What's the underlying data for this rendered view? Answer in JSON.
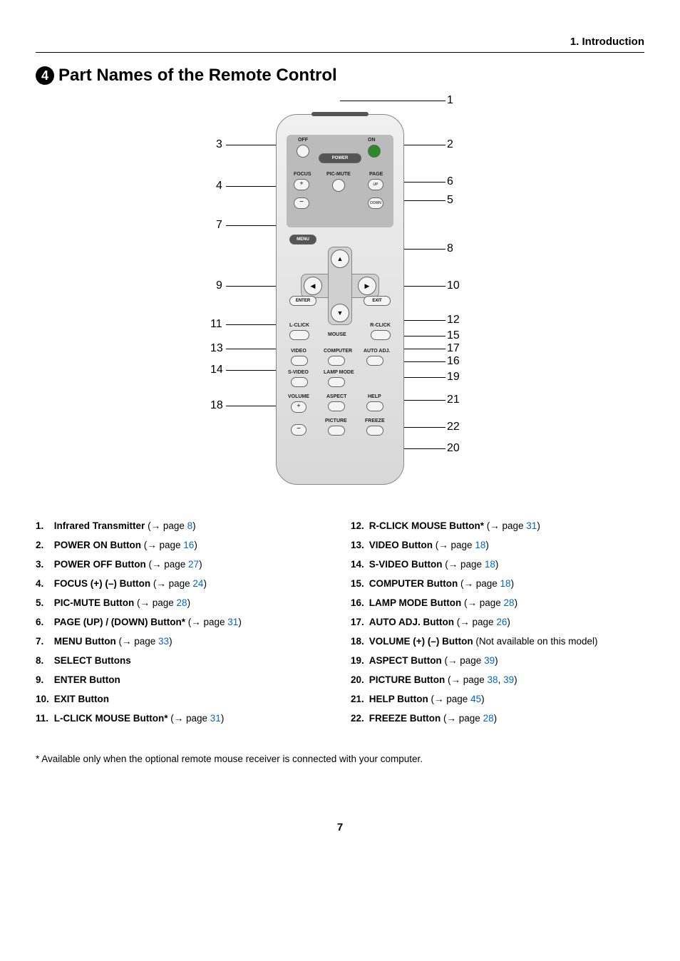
{
  "header": {
    "section": "1. Introduction"
  },
  "title": {
    "num": "4",
    "text": "Part Names of the Remote Control"
  },
  "remote_labels": {
    "off": "OFF",
    "on": "ON",
    "power": "POWER",
    "focus": "FOCUS",
    "picmute": "PIC-MUTE",
    "page": "PAGE",
    "up": "UP",
    "down": "DOWN",
    "menu": "MENU",
    "enter": "ENTER",
    "exit": "EXIT",
    "lclick": "L-CLICK",
    "rclick": "R-CLICK",
    "mouse": "MOUSE",
    "video": "VIDEO",
    "computer": "COMPUTER",
    "autoadj": "AUTO ADJ.",
    "svideo": "S-VIDEO",
    "lampmode": "LAMP MODE",
    "volume": "VOLUME",
    "aspect": "ASPECT",
    "help": "HELP",
    "picture": "PICTURE",
    "freeze": "FREEZE"
  },
  "callouts": {
    "1": "1",
    "2": "2",
    "3": "3",
    "4": "4",
    "5": "5",
    "6": "6",
    "7": "7",
    "8": "8",
    "9": "9",
    "10": "10",
    "11": "11",
    "12": "12",
    "13": "13",
    "14": "14",
    "15": "15",
    "16": "16",
    "17": "17",
    "18": "18",
    "19": "19",
    "20": "20",
    "21": "21",
    "22": "22"
  },
  "list_left": [
    {
      "n": "1.",
      "name": "Infrared Transmitter",
      "arrow": "→ page ",
      "page": "8",
      "close": ")"
    },
    {
      "n": "2.",
      "name": "POWER ON Button",
      "arrow": "→ page ",
      "page": "16",
      "close": ")"
    },
    {
      "n": "3.",
      "name": "POWER OFF Button",
      "arrow": "→ page ",
      "page": "27",
      "close": ")"
    },
    {
      "n": "4.",
      "name": "FOCUS (+) (–) Button",
      "arrow": "→ page ",
      "page": "24",
      "close": ")"
    },
    {
      "n": "5.",
      "name": "PIC-MUTE Button",
      "arrow": "→ page ",
      "page": "28",
      "close": ")"
    },
    {
      "n": "6.",
      "name": "PAGE (UP) / (DOWN) Button*",
      "arrow": "→ page ",
      "page": "31",
      "close": ")"
    },
    {
      "n": "7.",
      "name": "MENU Button",
      "arrow": "→ page ",
      "page": "33",
      "close": ")"
    },
    {
      "n": "8.",
      "name": "SELECT Buttons",
      "arrow": "",
      "page": "",
      "close": ""
    },
    {
      "n": "9.",
      "name": "ENTER Button",
      "arrow": "",
      "page": "",
      "close": ""
    },
    {
      "n": "10.",
      "name": "EXIT Button",
      "arrow": "",
      "page": "",
      "close": ""
    },
    {
      "n": "11.",
      "name": "L-CLICK MOUSE Button*",
      "arrow": "→ page ",
      "page": "31",
      "close": ")"
    }
  ],
  "list_right": [
    {
      "n": "12.",
      "name": "R-CLICK MOUSE Button*",
      "arrow": "→ page ",
      "page": "31",
      "close": ")"
    },
    {
      "n": "13.",
      "name": "VIDEO Button",
      "arrow": "→ page ",
      "page": "18",
      "close": ")"
    },
    {
      "n": "14.",
      "name": "S-VIDEO Button",
      "arrow": "→ page ",
      "page": "18",
      "close": ")"
    },
    {
      "n": "15.",
      "name": "COMPUTER Button",
      "arrow": "→ page ",
      "page": "18",
      "close": ")"
    },
    {
      "n": "16.",
      "name": "LAMP MODE Button",
      "arrow": "→ page ",
      "page": "28",
      "close": ")"
    },
    {
      "n": "17.",
      "name": "AUTO ADJ. Button",
      "arrow": "→ page ",
      "page": "26",
      "close": ")"
    },
    {
      "n": "18.",
      "name": "VOLUME (+) (–) Button",
      "note": " (Not available on this model)",
      "arrow": "",
      "page": "",
      "close": ""
    },
    {
      "n": "19.",
      "name": "ASPECT Button",
      "arrow": "→ page ",
      "page": "39",
      "close": ")"
    },
    {
      "n": "20.",
      "name": "PICTURE Button",
      "arrow": "→ page ",
      "page": "38",
      "page2": "39",
      "close": ")"
    },
    {
      "n": "21.",
      "name": "HELP Button",
      "arrow": "→ page ",
      "page": "45",
      "close": ")"
    },
    {
      "n": "22.",
      "name": "FREEZE Button",
      "arrow": "→ page ",
      "page": "28",
      "close": ")"
    }
  ],
  "footnote": "* Available only when the optional remote mouse receiver is connected with your computer.",
  "page_number": "7",
  "sep": ", "
}
